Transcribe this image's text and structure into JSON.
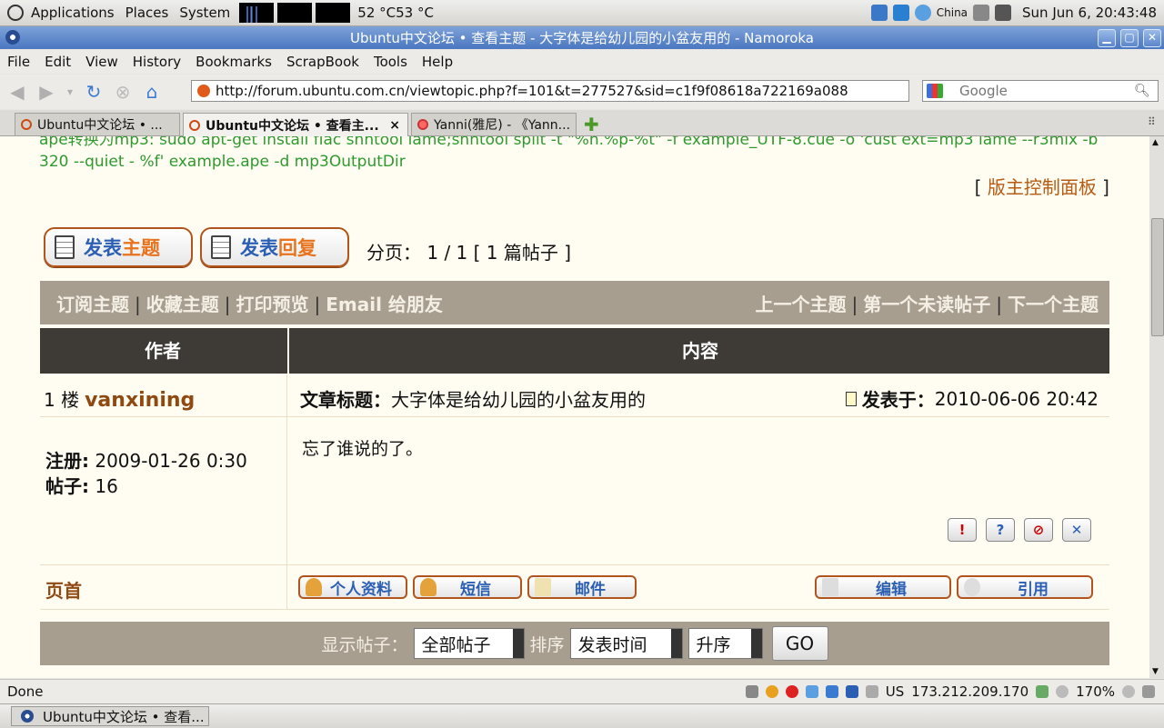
{
  "panel": {
    "menus": [
      "Applications",
      "Places",
      "System"
    ],
    "temps": "52 °C53 °C",
    "locale": "China",
    "clock": "Sun Jun  6, 20:43:48"
  },
  "window": {
    "title": "Ubuntu中文论坛 • 查看主题 - 大字体是给幼儿园的小盆友用的 - Namoroka"
  },
  "menubar": [
    "File",
    "Edit",
    "View",
    "History",
    "Bookmarks",
    "ScrapBook",
    "Tools",
    "Help"
  ],
  "navbar": {
    "url": "http://forum.ubuntu.com.cn/viewtopic.php?f=101&t=277527&sid=c1f9f08618a722169a088",
    "search_placeholder": "Google"
  },
  "tabs": [
    {
      "label": "Ubuntu中文论坛 • ..."
    },
    {
      "label": "Ubuntu中文论坛 • 查看主...",
      "close": "×"
    },
    {
      "label": "Yanni(雅尼) - 《Yann..."
    }
  ],
  "content": {
    "code_line": "ape转换为mp3:  sudo apt-get install flac shntool lame;shntool split -t \"%n.%p-%t\" -f example_UTF-8.cue -o 'cust ext=mp3 lame --r3mix -b 320 --quiet - %f' example.ape -d mp3OutputDir",
    "mod_panel": "版主控制面板",
    "new_topic": {
      "a": "发表",
      "b": "主题"
    },
    "reply": {
      "a": "发表",
      "b": "回复"
    },
    "pager": "分页：  1 / 1   [ 1 篇帖子 ]",
    "toolbar_left": [
      "订阅主题",
      "收藏主题",
      "打印预览",
      "Email 给朋友"
    ],
    "toolbar_right": [
      "上一个主题",
      "第一个未读帖子",
      "下一个主题"
    ],
    "col_author": "作者",
    "col_content": "内容",
    "post": {
      "floor": "1 楼",
      "username": "vanxining",
      "title_label": "文章标题：",
      "title": "大字体是给幼儿园的小盆友用的",
      "time_label": "发表于：",
      "time": "2010-06-06 20:42",
      "reg_label": "注册:",
      "reg": "2009-01-26 0:30",
      "posts_label": "帖子:",
      "posts": "16",
      "message": "忘了谁说的了。",
      "top_link": "页首",
      "buttons": [
        "个人资料",
        "短信",
        "邮件"
      ],
      "edit_button": "编辑",
      "quote_button": "引用"
    },
    "footer": {
      "show_label": "显示帖子：",
      "show_value": "全部帖子",
      "sort_label": "排序",
      "sort_value": "发表时间",
      "order_value": "升序",
      "go": "GO"
    }
  },
  "status": {
    "text": "Done",
    "kb": "US",
    "ip": "173.212.209.170",
    "zoom": "170%"
  },
  "taskbar": {
    "item": "Ubuntu中文论坛 • 查看..."
  }
}
